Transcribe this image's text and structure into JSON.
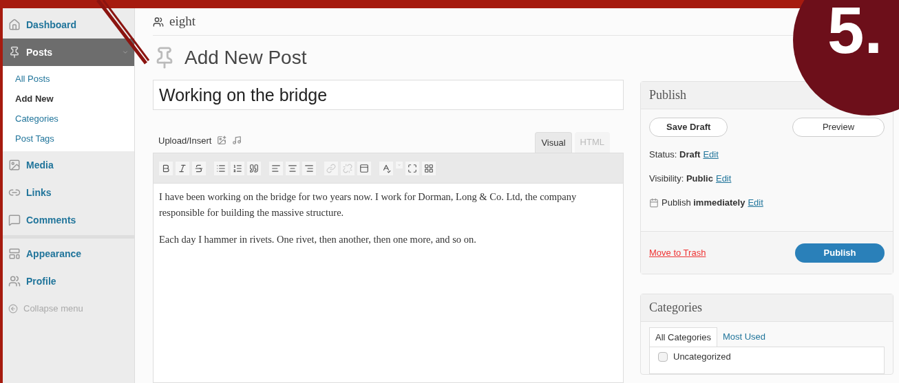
{
  "callout": {
    "number": "5."
  },
  "sidebar": {
    "items": [
      {
        "kind": "menu",
        "label": "Dashboard",
        "selected": false
      },
      {
        "kind": "menu",
        "label": "Posts",
        "selected": true,
        "children": [
          {
            "label": "All Posts",
            "selected": false
          },
          {
            "label": "Add New",
            "selected": true
          },
          {
            "label": "Categories",
            "selected": false
          },
          {
            "label": "Post Tags",
            "selected": false
          }
        ]
      },
      {
        "kind": "menu",
        "label": "Media",
        "selected": false
      },
      {
        "kind": "menu",
        "label": "Links",
        "selected": false
      },
      {
        "kind": "menu",
        "label": "Comments",
        "selected": false
      },
      {
        "kind": "separator"
      },
      {
        "kind": "menu",
        "label": "Appearance",
        "selected": false
      },
      {
        "kind": "menu",
        "label": "Profile",
        "selected": false
      },
      {
        "kind": "collapse",
        "label": "Collapse menu"
      }
    ]
  },
  "site": {
    "name": "eight"
  },
  "page": {
    "title": "Add New Post"
  },
  "post": {
    "title_value": "Working on the bridge"
  },
  "editor": {
    "upload_label": "Upload/Insert",
    "tabs": [
      {
        "label": "Visual",
        "selected": true
      },
      {
        "label": "HTML",
        "selected": false
      }
    ],
    "paragraphs": [
      "I have been working on the bridge for two years now. I work for Dorman, Long & Co. Ltd, the company responsible for building the massive structure.",
      "Each day I hammer in rivets. One rivet, then another, then one more, and so on."
    ]
  },
  "publish": {
    "title": "Publish",
    "save_draft": "Save Draft",
    "preview": "Preview",
    "rows": [
      {
        "kind": "plain",
        "text": "Status: **Draft**",
        "link": "Edit"
      },
      {
        "kind": "plain",
        "text": "Visibility: **Public**",
        "link": "Edit"
      },
      {
        "kind": "calendar",
        "text": "Publish **immediately**",
        "link": "Edit"
      }
    ],
    "trash": "Move to Trash",
    "publish_button": "Publish"
  },
  "categories": {
    "title": "Categories",
    "tabs": [
      {
        "label": "All Categories",
        "selected": true
      },
      {
        "label": "Most Used",
        "selected": false
      }
    ],
    "items": [
      {
        "label": "Uncategorized",
        "checked": false
      }
    ]
  }
}
